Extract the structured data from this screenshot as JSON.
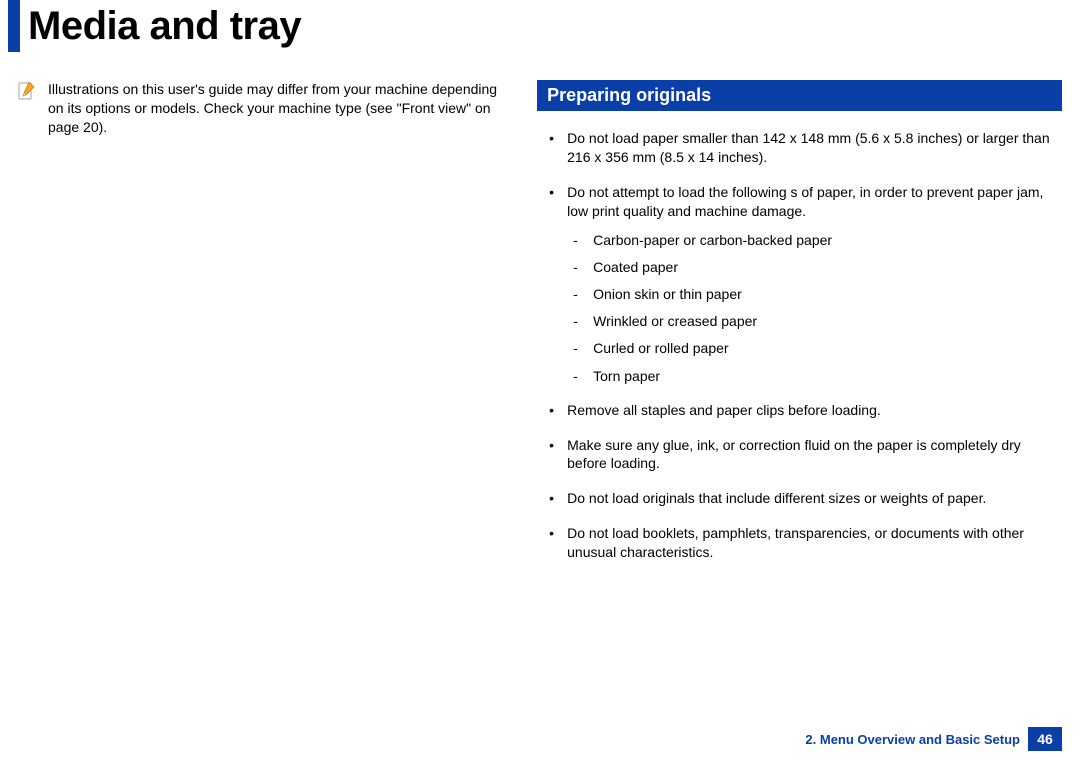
{
  "header": {
    "title": "Media and tray"
  },
  "note": {
    "icon_name": "note-pencil-icon",
    "text": "Illustrations on this user's guide may differ from your machine depending on its options or models. Check your machine type (see \"Front view\" on page 20)."
  },
  "section": {
    "title": "Preparing originals",
    "bullets": [
      {
        "text": "Do not load paper smaller than 142 x 148 mm (5.6 x 5.8 inches) or larger than 216 x 356 mm (8.5 x 14 inches)."
      },
      {
        "text": "Do not attempt to load the following s of paper, in order to prevent paper jam, low print quality and machine damage.",
        "sub": [
          "Carbon-paper or carbon-backed paper",
          "Coated paper",
          "Onion skin or thin paper",
          "Wrinkled or creased paper",
          "Curled or rolled paper",
          "Torn paper"
        ]
      },
      {
        "text": "Remove all staples and paper clips before loading."
      },
      {
        "text": "Make sure any glue, ink, or correction fluid on the paper is completely dry before loading."
      },
      {
        "text": "Do not load originals that include different sizes or weights of paper."
      },
      {
        "text": "Do not load booklets, pamphlets, transparencies, or documents with other unusual characteristics."
      }
    ]
  },
  "footer": {
    "chapter": "2. Menu Overview and Basic Setup",
    "page": "46"
  }
}
